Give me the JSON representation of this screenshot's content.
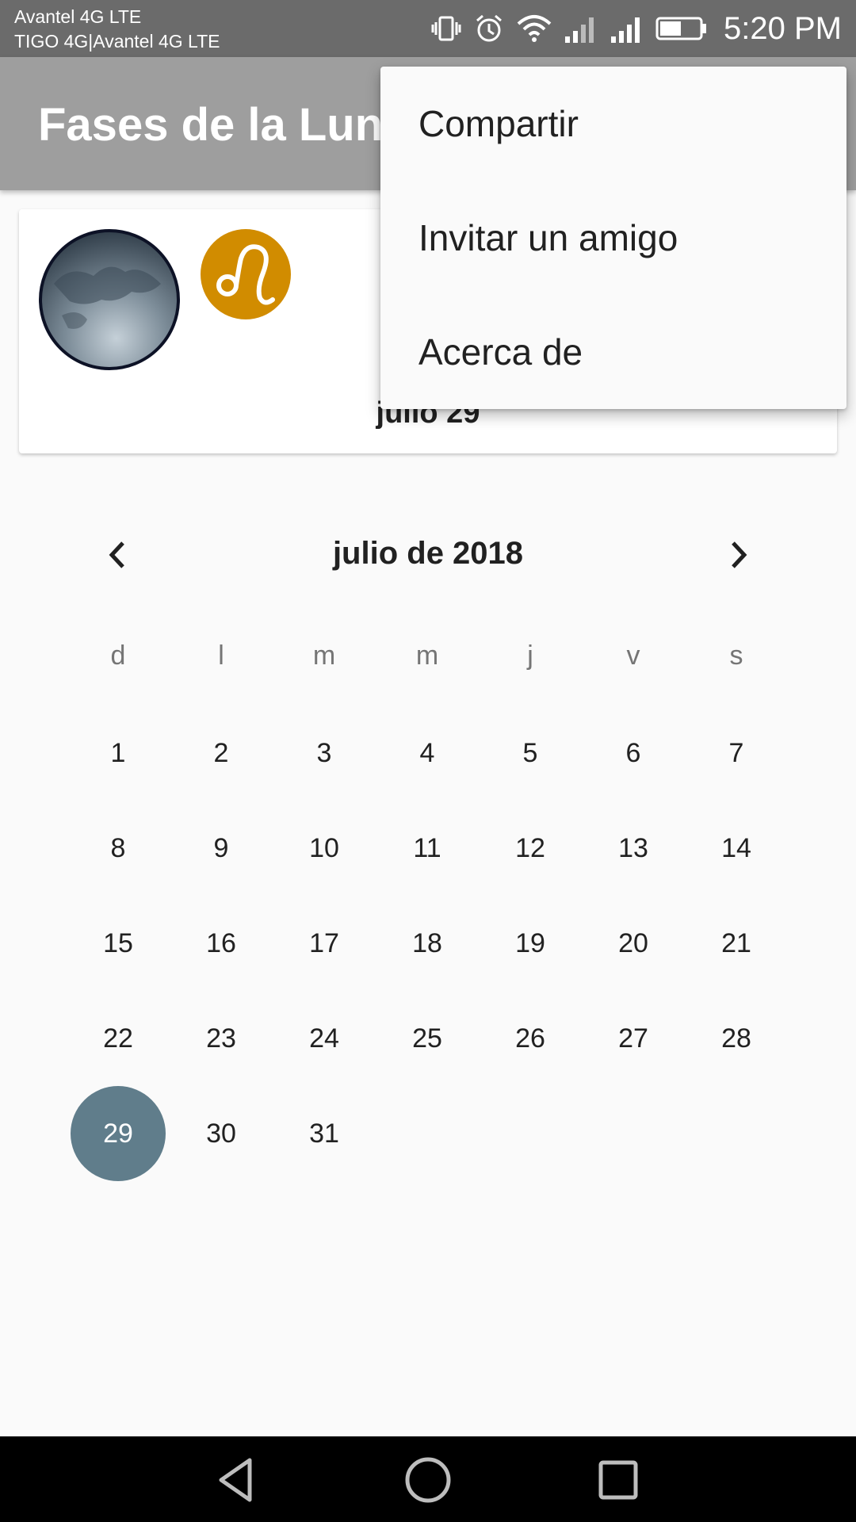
{
  "status_bar": {
    "carrier_1": "Avantel 4G LTE",
    "carrier_2": "TIGO 4G|Avantel 4G LTE",
    "time": "5:20 PM",
    "icons": [
      "vibrate-icon",
      "alarm-icon",
      "wifi-icon",
      "signal-icon",
      "signal-icon",
      "battery-icon"
    ]
  },
  "app_bar": {
    "title": "Fases de la Luna"
  },
  "moon_card": {
    "date": "julio 29",
    "icons": [
      "moon-phase-icon",
      "leo-zodiac-icon"
    ],
    "zodiac_color": "#d18c00"
  },
  "calendar": {
    "month_title": "julio de 2018",
    "weekdays": [
      "d",
      "l",
      "m",
      "m",
      "j",
      "v",
      "s"
    ],
    "days": [
      "1",
      "2",
      "3",
      "4",
      "5",
      "6",
      "7",
      "8",
      "9",
      "10",
      "11",
      "12",
      "13",
      "14",
      "15",
      "16",
      "17",
      "18",
      "19",
      "20",
      "21",
      "22",
      "23",
      "24",
      "25",
      "26",
      "27",
      "28",
      "29",
      "30",
      "31"
    ],
    "selected_day": "29",
    "selected_color": "#607d8b"
  },
  "overflow_menu": {
    "items": [
      "Compartir",
      "Invitar un amigo",
      "Acerca de"
    ]
  },
  "nav_bar": {
    "icons": [
      "back-icon",
      "home-icon",
      "recents-icon"
    ]
  }
}
